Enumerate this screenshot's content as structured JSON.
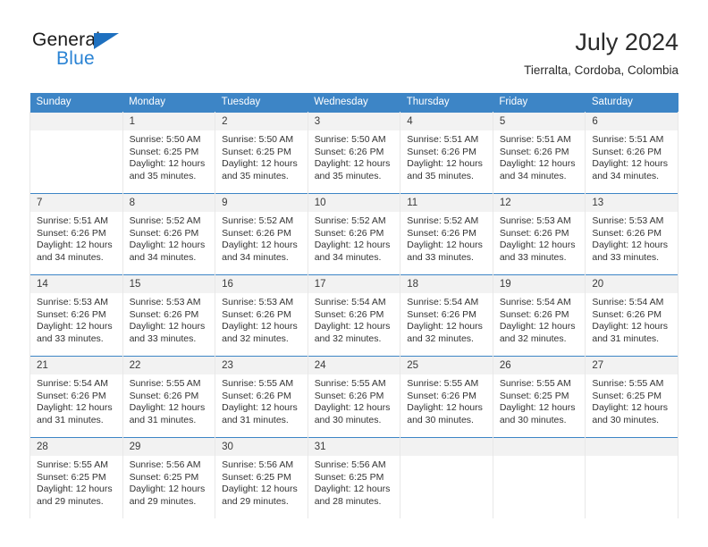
{
  "brand": {
    "name_part1": "General",
    "name_part2": "Blue",
    "triangle_color": "#1e70bf",
    "blue_color": "#2a83d4"
  },
  "header": {
    "title": "July 2024",
    "subtitle": "Tierralta, Cordoba, Colombia"
  },
  "theme": {
    "header_bg": "#3d85c6",
    "daynum_bg": "#f2f2f2",
    "row_rule": "#3d85c6",
    "cell_border": "#e8e8e8"
  },
  "weekdays": [
    "Sunday",
    "Monday",
    "Tuesday",
    "Wednesday",
    "Thursday",
    "Friday",
    "Saturday"
  ],
  "weeks": [
    [
      {
        "day": "",
        "sunrise": "",
        "sunset": "",
        "daylight_line1": "",
        "daylight_line2": "",
        "empty": true
      },
      {
        "day": "1",
        "sunrise": "Sunrise: 5:50 AM",
        "sunset": "Sunset: 6:25 PM",
        "daylight_line1": "Daylight: 12 hours",
        "daylight_line2": "and 35 minutes."
      },
      {
        "day": "2",
        "sunrise": "Sunrise: 5:50 AM",
        "sunset": "Sunset: 6:25 PM",
        "daylight_line1": "Daylight: 12 hours",
        "daylight_line2": "and 35 minutes."
      },
      {
        "day": "3",
        "sunrise": "Sunrise: 5:50 AM",
        "sunset": "Sunset: 6:26 PM",
        "daylight_line1": "Daylight: 12 hours",
        "daylight_line2": "and 35 minutes."
      },
      {
        "day": "4",
        "sunrise": "Sunrise: 5:51 AM",
        "sunset": "Sunset: 6:26 PM",
        "daylight_line1": "Daylight: 12 hours",
        "daylight_line2": "and 35 minutes."
      },
      {
        "day": "5",
        "sunrise": "Sunrise: 5:51 AM",
        "sunset": "Sunset: 6:26 PM",
        "daylight_line1": "Daylight: 12 hours",
        "daylight_line2": "and 34 minutes."
      },
      {
        "day": "6",
        "sunrise": "Sunrise: 5:51 AM",
        "sunset": "Sunset: 6:26 PM",
        "daylight_line1": "Daylight: 12 hours",
        "daylight_line2": "and 34 minutes."
      }
    ],
    [
      {
        "day": "7",
        "sunrise": "Sunrise: 5:51 AM",
        "sunset": "Sunset: 6:26 PM",
        "daylight_line1": "Daylight: 12 hours",
        "daylight_line2": "and 34 minutes."
      },
      {
        "day": "8",
        "sunrise": "Sunrise: 5:52 AM",
        "sunset": "Sunset: 6:26 PM",
        "daylight_line1": "Daylight: 12 hours",
        "daylight_line2": "and 34 minutes."
      },
      {
        "day": "9",
        "sunrise": "Sunrise: 5:52 AM",
        "sunset": "Sunset: 6:26 PM",
        "daylight_line1": "Daylight: 12 hours",
        "daylight_line2": "and 34 minutes."
      },
      {
        "day": "10",
        "sunrise": "Sunrise: 5:52 AM",
        "sunset": "Sunset: 6:26 PM",
        "daylight_line1": "Daylight: 12 hours",
        "daylight_line2": "and 34 minutes."
      },
      {
        "day": "11",
        "sunrise": "Sunrise: 5:52 AM",
        "sunset": "Sunset: 6:26 PM",
        "daylight_line1": "Daylight: 12 hours",
        "daylight_line2": "and 33 minutes."
      },
      {
        "day": "12",
        "sunrise": "Sunrise: 5:53 AM",
        "sunset": "Sunset: 6:26 PM",
        "daylight_line1": "Daylight: 12 hours",
        "daylight_line2": "and 33 minutes."
      },
      {
        "day": "13",
        "sunrise": "Sunrise: 5:53 AM",
        "sunset": "Sunset: 6:26 PM",
        "daylight_line1": "Daylight: 12 hours",
        "daylight_line2": "and 33 minutes."
      }
    ],
    [
      {
        "day": "14",
        "sunrise": "Sunrise: 5:53 AM",
        "sunset": "Sunset: 6:26 PM",
        "daylight_line1": "Daylight: 12 hours",
        "daylight_line2": "and 33 minutes."
      },
      {
        "day": "15",
        "sunrise": "Sunrise: 5:53 AM",
        "sunset": "Sunset: 6:26 PM",
        "daylight_line1": "Daylight: 12 hours",
        "daylight_line2": "and 33 minutes."
      },
      {
        "day": "16",
        "sunrise": "Sunrise: 5:53 AM",
        "sunset": "Sunset: 6:26 PM",
        "daylight_line1": "Daylight: 12 hours",
        "daylight_line2": "and 32 minutes."
      },
      {
        "day": "17",
        "sunrise": "Sunrise: 5:54 AM",
        "sunset": "Sunset: 6:26 PM",
        "daylight_line1": "Daylight: 12 hours",
        "daylight_line2": "and 32 minutes."
      },
      {
        "day": "18",
        "sunrise": "Sunrise: 5:54 AM",
        "sunset": "Sunset: 6:26 PM",
        "daylight_line1": "Daylight: 12 hours",
        "daylight_line2": "and 32 minutes."
      },
      {
        "day": "19",
        "sunrise": "Sunrise: 5:54 AM",
        "sunset": "Sunset: 6:26 PM",
        "daylight_line1": "Daylight: 12 hours",
        "daylight_line2": "and 32 minutes."
      },
      {
        "day": "20",
        "sunrise": "Sunrise: 5:54 AM",
        "sunset": "Sunset: 6:26 PM",
        "daylight_line1": "Daylight: 12 hours",
        "daylight_line2": "and 31 minutes."
      }
    ],
    [
      {
        "day": "21",
        "sunrise": "Sunrise: 5:54 AM",
        "sunset": "Sunset: 6:26 PM",
        "daylight_line1": "Daylight: 12 hours",
        "daylight_line2": "and 31 minutes."
      },
      {
        "day": "22",
        "sunrise": "Sunrise: 5:55 AM",
        "sunset": "Sunset: 6:26 PM",
        "daylight_line1": "Daylight: 12 hours",
        "daylight_line2": "and 31 minutes."
      },
      {
        "day": "23",
        "sunrise": "Sunrise: 5:55 AM",
        "sunset": "Sunset: 6:26 PM",
        "daylight_line1": "Daylight: 12 hours",
        "daylight_line2": "and 31 minutes."
      },
      {
        "day": "24",
        "sunrise": "Sunrise: 5:55 AM",
        "sunset": "Sunset: 6:26 PM",
        "daylight_line1": "Daylight: 12 hours",
        "daylight_line2": "and 30 minutes."
      },
      {
        "day": "25",
        "sunrise": "Sunrise: 5:55 AM",
        "sunset": "Sunset: 6:26 PM",
        "daylight_line1": "Daylight: 12 hours",
        "daylight_line2": "and 30 minutes."
      },
      {
        "day": "26",
        "sunrise": "Sunrise: 5:55 AM",
        "sunset": "Sunset: 6:25 PM",
        "daylight_line1": "Daylight: 12 hours",
        "daylight_line2": "and 30 minutes."
      },
      {
        "day": "27",
        "sunrise": "Sunrise: 5:55 AM",
        "sunset": "Sunset: 6:25 PM",
        "daylight_line1": "Daylight: 12 hours",
        "daylight_line2": "and 30 minutes."
      }
    ],
    [
      {
        "day": "28",
        "sunrise": "Sunrise: 5:55 AM",
        "sunset": "Sunset: 6:25 PM",
        "daylight_line1": "Daylight: 12 hours",
        "daylight_line2": "and 29 minutes."
      },
      {
        "day": "29",
        "sunrise": "Sunrise: 5:56 AM",
        "sunset": "Sunset: 6:25 PM",
        "daylight_line1": "Daylight: 12 hours",
        "daylight_line2": "and 29 minutes."
      },
      {
        "day": "30",
        "sunrise": "Sunrise: 5:56 AM",
        "sunset": "Sunset: 6:25 PM",
        "daylight_line1": "Daylight: 12 hours",
        "daylight_line2": "and 29 minutes."
      },
      {
        "day": "31",
        "sunrise": "Sunrise: 5:56 AM",
        "sunset": "Sunset: 6:25 PM",
        "daylight_line1": "Daylight: 12 hours",
        "daylight_line2": "and 28 minutes."
      },
      {
        "day": "",
        "sunrise": "",
        "sunset": "",
        "daylight_line1": "",
        "daylight_line2": "",
        "empty": true
      },
      {
        "day": "",
        "sunrise": "",
        "sunset": "",
        "daylight_line1": "",
        "daylight_line2": "",
        "empty": true
      },
      {
        "day": "",
        "sunrise": "",
        "sunset": "",
        "daylight_line1": "",
        "daylight_line2": "",
        "empty": true
      }
    ]
  ]
}
